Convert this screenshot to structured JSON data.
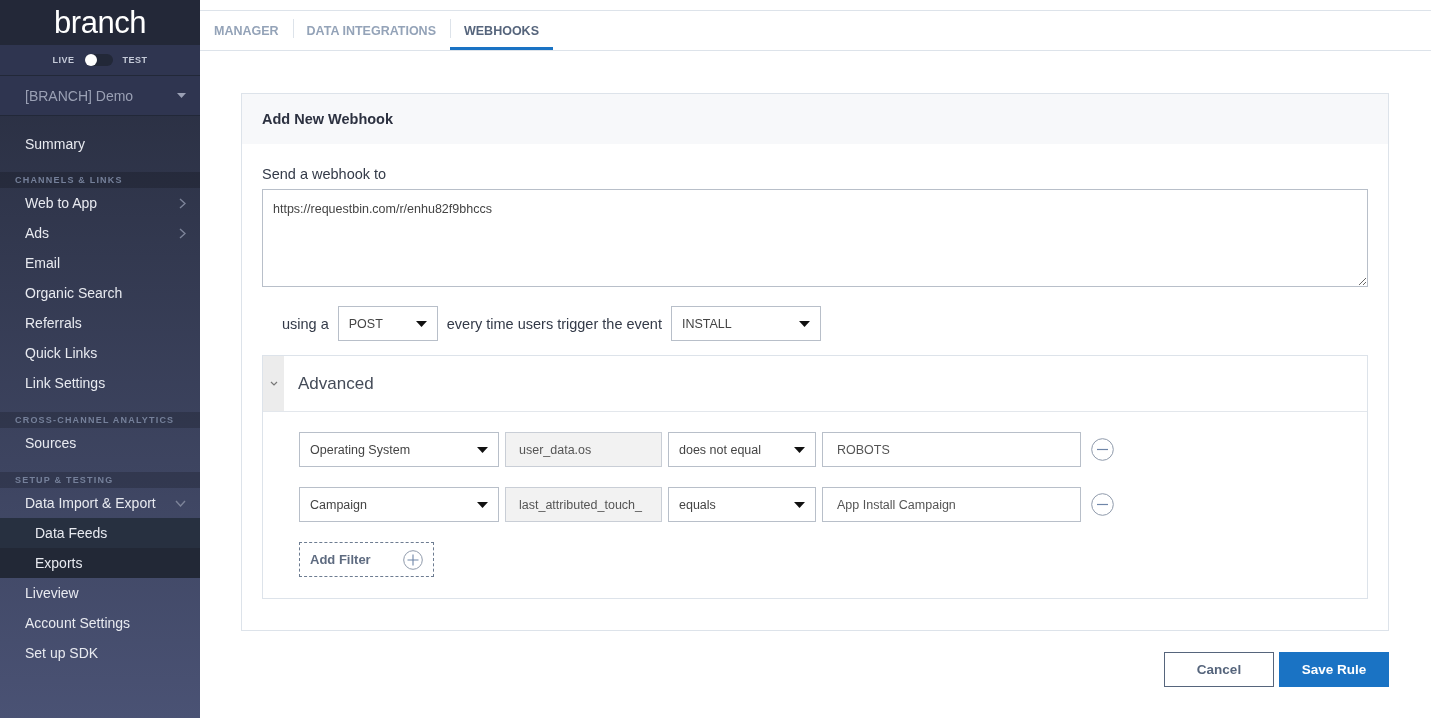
{
  "sidebar": {
    "logo": "branch",
    "mode_toggle": {
      "left_label": "LIVE",
      "right_label": "TEST",
      "on": false
    },
    "project_selector": {
      "value": "[BRANCH] Demo"
    },
    "sections": [
      {
        "items": [
          {
            "label": "Summary",
            "kind": "link"
          }
        ]
      },
      {
        "heading": "CHANNELS & LINKS",
        "items": [
          {
            "label": "Web to App",
            "kind": "group",
            "expanded": false
          },
          {
            "label": "Ads",
            "kind": "group",
            "expanded": false
          },
          {
            "label": "Email",
            "kind": "link"
          },
          {
            "label": "Organic Search",
            "kind": "link"
          },
          {
            "label": "Referrals",
            "kind": "link"
          },
          {
            "label": "Quick Links",
            "kind": "link"
          },
          {
            "label": "Link Settings",
            "kind": "link"
          }
        ]
      },
      {
        "heading": "CROSS-CHANNEL ANALYTICS",
        "items": [
          {
            "label": "Sources",
            "kind": "link"
          }
        ]
      },
      {
        "heading": "SETUP & TESTING",
        "items": [
          {
            "label": "Data Import & Export",
            "kind": "group",
            "expanded": true,
            "children": [
              {
                "label": "Data Feeds"
              },
              {
                "label": "Exports"
              }
            ]
          },
          {
            "label": "Liveview",
            "kind": "link"
          },
          {
            "label": "Account Settings",
            "kind": "link"
          },
          {
            "label": "Set up SDK",
            "kind": "link"
          }
        ]
      }
    ]
  },
  "tabs": [
    {
      "label": "MANAGER",
      "selected": false
    },
    {
      "label": "DATA INTEGRATIONS",
      "selected": false
    },
    {
      "label": "WEBHOOKS",
      "selected": true
    }
  ],
  "card": {
    "title": "Add New Webhook",
    "url_label": "Send a webhook to",
    "url_value": "https://requestbin.com/r/enhu82f9bhccs",
    "method_prefix": "using a",
    "method": "POST",
    "event_prefix": "every time users trigger the event",
    "event": "INSTALL",
    "advanced": {
      "title": "Advanced",
      "expanded": true,
      "filters": [
        {
          "field": "Operating System",
          "property": "user_data.os",
          "operator": "does not equal",
          "value": "ROBOTS"
        },
        {
          "field": "Campaign",
          "property": "last_attributed_touch_",
          "operator": "equals",
          "value": "App Install Campaign"
        }
      ],
      "add_label": "Add Filter"
    }
  },
  "buttons": [
    {
      "label": "Cancel",
      "kind": "secondary"
    },
    {
      "label": "Save Rule",
      "kind": "primary"
    }
  ]
}
